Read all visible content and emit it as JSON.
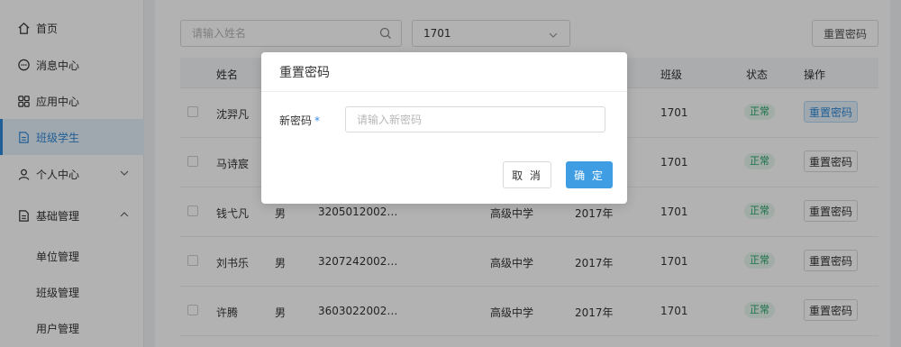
{
  "sidebar": {
    "items": [
      {
        "label": "首页",
        "icon": "home-icon"
      },
      {
        "label": "消息中心",
        "icon": "message-icon"
      },
      {
        "label": "应用中心",
        "icon": "apps-grid-icon"
      },
      {
        "label": "班级学生",
        "icon": "document-icon"
      },
      {
        "label": "个人中心",
        "icon": "user-icon"
      },
      {
        "label": "基础管理",
        "icon": "file-icon"
      }
    ],
    "sub_items": [
      {
        "label": "单位管理"
      },
      {
        "label": "班级管理"
      },
      {
        "label": "用户管理"
      }
    ],
    "active_color": "#2f89d6"
  },
  "toolbar": {
    "search_placeholder": "请输入姓名",
    "class_select_value": "1701",
    "reset_label": "重置密码"
  },
  "table": {
    "headers": {
      "name": "姓名",
      "class": "班级",
      "status": "状态",
      "action": "操作"
    },
    "rows": [
      {
        "name": "沈羿凡",
        "gender": "",
        "id": "",
        "school_type": "",
        "year": "",
        "class": "1701",
        "status": "正常",
        "action": "重置密码"
      },
      {
        "name": "马诗宸",
        "gender": "",
        "id": "",
        "school_type": "",
        "year": "",
        "class": "1701",
        "status": "正常",
        "action": "重置密码"
      },
      {
        "name": "钱弋凡",
        "gender": "男",
        "id": "3205012002…",
        "school_type": "高级中学",
        "year": "2017年",
        "class": "1701",
        "status": "正常",
        "action": "重置密码"
      },
      {
        "name": "刘书乐",
        "gender": "男",
        "id": "3207242002…",
        "school_type": "高级中学",
        "year": "2017年",
        "class": "1701",
        "status": "正常",
        "action": "重置密码"
      },
      {
        "name": "许腾",
        "gender": "男",
        "id": "3603022002…",
        "school_type": "高级中学",
        "year": "2017年",
        "class": "1701",
        "status": "正常",
        "action": "重置密码"
      }
    ]
  },
  "modal": {
    "title": "重置密码",
    "field_label": "新密码",
    "required_mark": "*",
    "placeholder": "请输入新密码",
    "cancel_label": "取 消",
    "confirm_label": "确 定",
    "confirm_color": "#3e9de3"
  }
}
